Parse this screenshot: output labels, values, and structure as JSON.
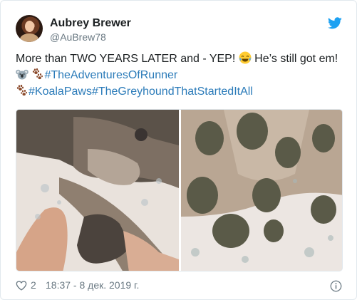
{
  "author": {
    "name": "Aubrey Brewer",
    "handle": "@AuBrew78"
  },
  "icons": {
    "brand": "twitter-bird-icon",
    "like": "heart-icon",
    "info": "info-icon",
    "emoji_laugh": "face-with-tears-of-joy-emoji",
    "emoji_koala": "koala-emoji",
    "emoji_paws": "paw-prints-emoji"
  },
  "tweet": {
    "line1_text": "More than TWO YEARS LATER and - YEP! ",
    "line1_tail": " He’s still got em!",
    "hashtag1": "#TheAdventuresOfRunner",
    "hashtag2": "#KoalaPaws",
    "hashtag3": "#TheGreyhoundThatStartedItAll"
  },
  "footer": {
    "likes": "2",
    "timestamp": "18:37 - 8 дек. 2019 г."
  },
  "colors": {
    "accent": "#1da1f2",
    "link": "#2b7bb9",
    "muted": "#697882",
    "text": "#1c2022",
    "border": "#e1e8ed"
  }
}
